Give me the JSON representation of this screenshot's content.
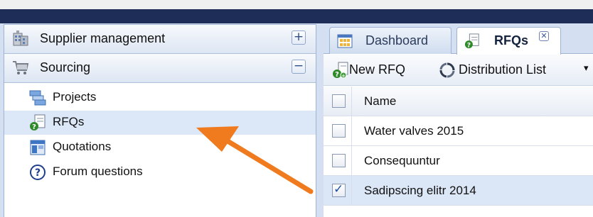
{
  "sidebar": {
    "sections": [
      {
        "label": "Supplier management",
        "toggle": "+",
        "icon": "building-icon",
        "expanded": false
      },
      {
        "label": "Sourcing",
        "toggle": "−",
        "icon": "cart-icon",
        "expanded": true
      }
    ],
    "items": [
      {
        "label": "Projects",
        "icon": "projects-icon",
        "selected": false
      },
      {
        "label": "RFQs",
        "icon": "rfq-icon",
        "selected": true
      },
      {
        "label": "Quotations",
        "icon": "quotations-icon",
        "selected": false
      },
      {
        "label": "Forum questions",
        "icon": "question-icon",
        "selected": false
      }
    ]
  },
  "tabs": [
    {
      "label": "Dashboard",
      "icon": "dashboard-icon",
      "active": false
    },
    {
      "label": "RFQs",
      "icon": "rfq-icon",
      "active": true,
      "close": "✕"
    }
  ],
  "toolbar": {
    "new_rfq_label": "New RFQ",
    "distribution_list_label": "Distribution List",
    "dropdown_caret": "▾"
  },
  "grid": {
    "column_header": "Name",
    "rows": [
      {
        "name": "Water valves 2015",
        "checked": false
      },
      {
        "name": "Consequuntur",
        "checked": false
      },
      {
        "name": "Sadipscing elitr 2014",
        "checked": true
      }
    ],
    "check_mark": "✓"
  },
  "colors": {
    "title_bar": "#1e2d57",
    "frame": "#d4e0f1",
    "selection": "#dce8f8",
    "annotation_arrow": "#f07a1e"
  }
}
